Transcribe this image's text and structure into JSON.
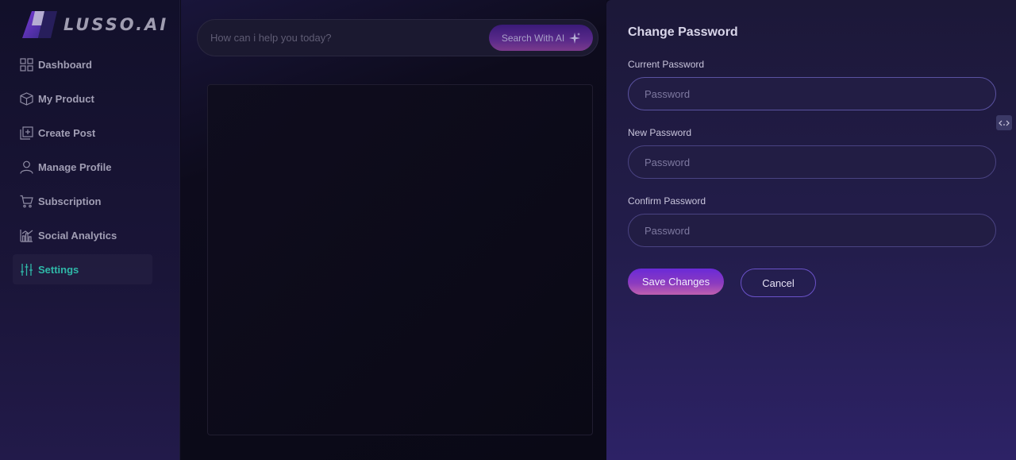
{
  "brand": {
    "logo_text": "LUSSO.AI"
  },
  "sidebar": {
    "items": [
      {
        "label": "Dashboard",
        "icon": "grid-icon",
        "active": false
      },
      {
        "label": "My Product",
        "icon": "box-icon",
        "active": false
      },
      {
        "label": "Create Post",
        "icon": "add-post-icon",
        "active": false
      },
      {
        "label": "Manage Profile",
        "icon": "user-icon",
        "active": false
      },
      {
        "label": "Subscription",
        "icon": "cart-icon",
        "active": false
      },
      {
        "label": "Social Analytics",
        "icon": "analytics-icon",
        "active": false
      },
      {
        "label": "Settings",
        "icon": "sliders-icon",
        "active": true
      }
    ]
  },
  "search": {
    "placeholder": "How can i help you today?",
    "button_label": "Search With AI"
  },
  "change_password": {
    "title": "Change Password",
    "current": {
      "label": "Current Password",
      "placeholder": "Password"
    },
    "new": {
      "label": "New Password",
      "placeholder": "Password"
    },
    "confirm": {
      "label": "Confirm Password",
      "placeholder": "Password"
    },
    "save_label": "Save Changes",
    "cancel_label": "Cancel"
  },
  "colors": {
    "accent_active": "#2fb8a8",
    "button_gradient_start": "#6a2ad8",
    "button_gradient_end": "#c060b0",
    "panel_bg": "#231d4c"
  }
}
